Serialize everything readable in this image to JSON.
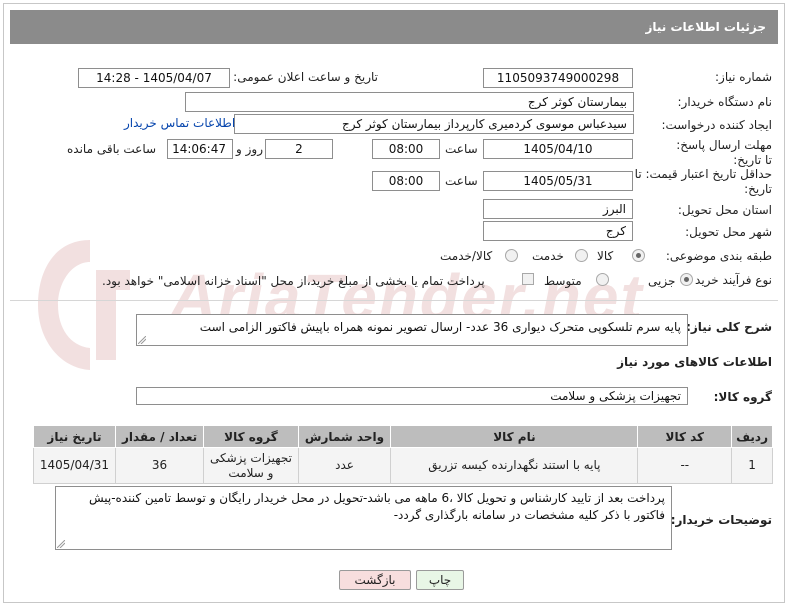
{
  "header": {
    "title": "جزئیات اطلاعات نیاز"
  },
  "form": {
    "need_number_label": "شماره نیاز:",
    "need_number_value": "1105093749000298",
    "announce_label": "تاریخ و ساعت اعلان عمومی:",
    "announce_value": "1405/04/07 - 14:28",
    "buyer_org_label": "نام دستگاه خریدار:",
    "buyer_org_value": "بیمارستان کوثر کرج",
    "requester_label": "ایجاد کننده درخواست:",
    "requester_value": "سیدعباس موسوی کردمیری کارپرداز بیمارستان کوثر کرج",
    "contact_link": "اطلاعات تماس خریدار",
    "reply_deadline_label": "مهلت ارسال پاسخ: تا تاریخ:",
    "reply_date": "1405/04/10",
    "time_label": "ساعت",
    "reply_time": "08:00",
    "days_value": "2",
    "days_label": "روز و",
    "remaining_time": "14:06:47",
    "remaining_label": "ساعت باقی مانده",
    "price_validity_label": "حداقل تاریخ اعتبار قیمت: تا تاریخ:",
    "price_date": "1405/05/31",
    "price_time": "08:00",
    "province_label": "استان محل تحویل:",
    "province_value": "البرز",
    "city_label": "شهر محل تحویل:",
    "city_value": "کرج",
    "category_label": "طبقه بندی موضوعی:",
    "category_options": [
      "کالا",
      "خدمت",
      "کالا/خدمت"
    ],
    "category_selected": "کالا",
    "process_label": "نوع فرآیند خرید :",
    "process_options": [
      "جزیی",
      "متوسط"
    ],
    "process_selected": "جزیی",
    "payment_note": "پرداخت تمام یا بخشی از مبلغ خرید،از محل \"اسناد خزانه اسلامی\" خواهد بود."
  },
  "description": {
    "label": "شرح کلی نیاز:",
    "value": "پایه سرم تلسکوپی متحرک  دیواری 36 عدد- ارسال تصویر نمونه همراه باپیش فاکتور الزامی است"
  },
  "goods": {
    "section_title": "اطلاعات کالاهای مورد نیاز",
    "group_label": "گروه کالا:",
    "group_value": "تجهیزات پزشکی و سلامت",
    "columns": [
      "ردیف",
      "کد کالا",
      "نام کالا",
      "واحد شمارش",
      "گروه کالا",
      "تعداد / مقدار",
      "تاریخ نیاز"
    ],
    "rows": [
      {
        "index": "1",
        "code": "--",
        "name": "پایه با استند نگهدارنده کیسه تزریق",
        "unit": "عدد",
        "group": "تجهیزات پزشکی و سلامت",
        "quantity": "36",
        "date": "1405/04/31"
      }
    ]
  },
  "buyer_notes": {
    "label": "توضیحات خریدار:",
    "value": "پرداخت بعد از تایید کارشناس و تحویل کالا ،6 ماهه می باشد-تحویل در محل خریدار رایگان و توسط تامین کننده-پیش فاکتور با ذکر کلیه مشخصات در سامانه بارگذاری گردد-"
  },
  "buttons": {
    "print": "چاپ",
    "back": "بازگشت"
  },
  "watermark": {
    "text": "AriaTender.net"
  },
  "colors": {
    "header_bg": "#8b8b8b",
    "link": "#0645ad",
    "print_bg": "#e8f6e6",
    "back_bg": "#f8dede"
  }
}
